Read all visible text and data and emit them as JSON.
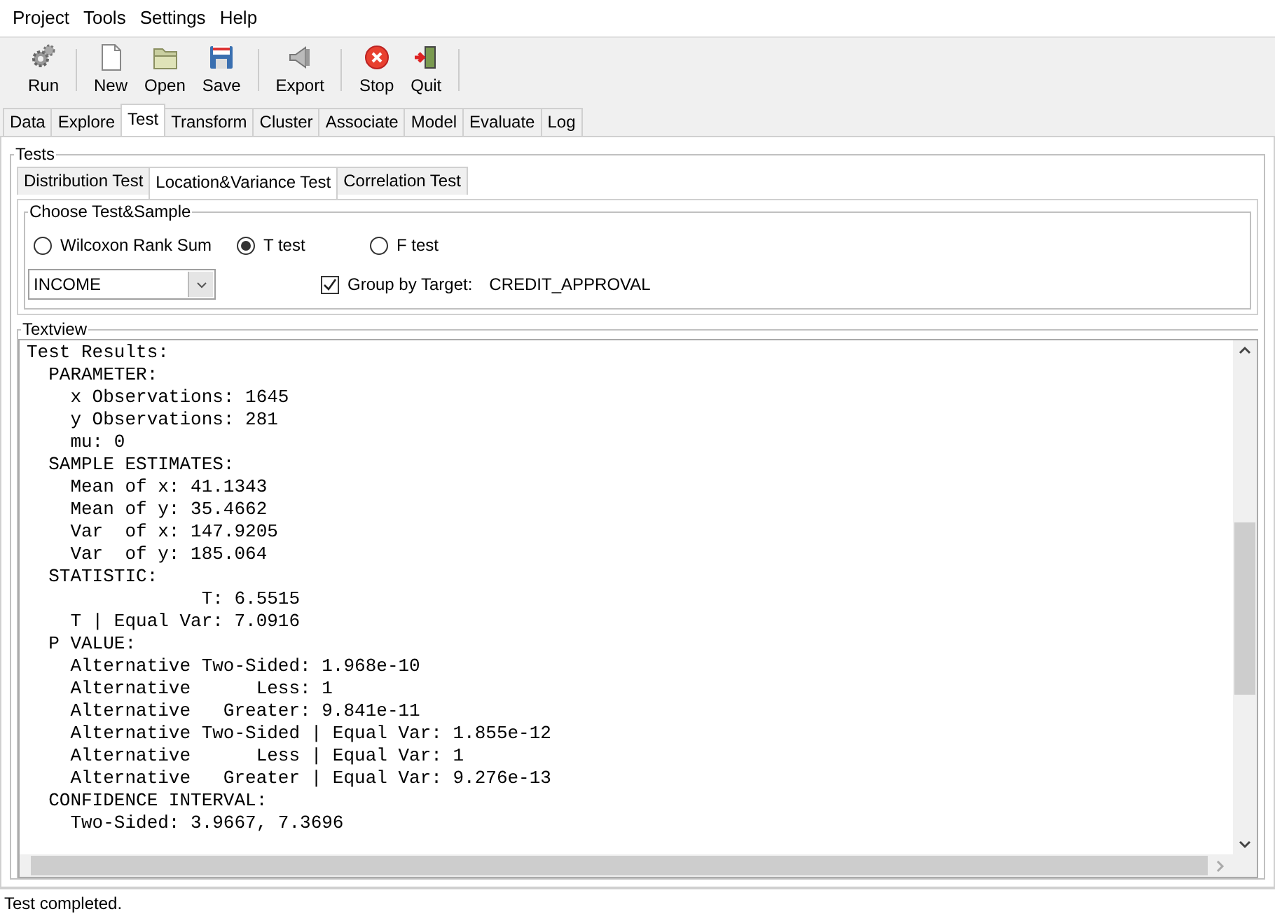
{
  "menu": [
    "Project",
    "Tools",
    "Settings",
    "Help"
  ],
  "toolbar": [
    {
      "label": "Run",
      "kind": "gears"
    },
    {
      "label": "New",
      "kind": "page"
    },
    {
      "label": "Open",
      "kind": "folder"
    },
    {
      "label": "Save",
      "kind": "disk"
    },
    {
      "label": "Export",
      "kind": "speaker"
    },
    {
      "label": "Stop",
      "kind": "stop"
    },
    {
      "label": "Quit",
      "kind": "exit"
    }
  ],
  "tabs": [
    {
      "label": "Data",
      "selected": false
    },
    {
      "label": "Explore",
      "selected": false
    },
    {
      "label": "Test",
      "selected": true
    },
    {
      "label": "Transform",
      "selected": false
    },
    {
      "label": "Cluster",
      "selected": false
    },
    {
      "label": "Associate",
      "selected": false
    },
    {
      "label": "Model",
      "selected": false
    },
    {
      "label": "Evaluate",
      "selected": false
    },
    {
      "label": "Log",
      "selected": false
    }
  ],
  "tests": {
    "title": "Tests",
    "tabs": [
      {
        "label": "Distribution Test",
        "selected": false
      },
      {
        "label": "Location&Variance Test",
        "selected": true
      },
      {
        "label": "Correlation Test",
        "selected": false
      }
    ],
    "choose": {
      "title": "Choose Test&Sample",
      "options": [
        {
          "label": "Wilcoxon Rank Sum",
          "selected": false
        },
        {
          "label": "T test",
          "selected": true
        },
        {
          "label": "F test",
          "selected": false
        }
      ],
      "variable": "INCOME",
      "group_by": {
        "label": "Group by Target:",
        "checked": true,
        "value": "CREDIT_APPROVAL"
      }
    },
    "textview": {
      "title": "Textview",
      "lines": [
        "Test Results:",
        "  PARAMETER:",
        "    x Observations: 1645",
        "    y Observations: 281",
        "    mu: 0",
        "  SAMPLE ESTIMATES:",
        "    Mean of x: 41.1343",
        "    Mean of y: 35.4662",
        "    Var  of x: 147.9205",
        "    Var  of y: 185.064",
        "  STATISTIC:",
        "                T: 6.5515",
        "    T | Equal Var: 7.0916",
        "  P VALUE:",
        "    Alternative Two-Sided: 1.968e-10",
        "    Alternative      Less: 1",
        "    Alternative   Greater: 9.841e-11",
        "    Alternative Two-Sided | Equal Var: 1.855e-12",
        "    Alternative      Less | Equal Var: 1",
        "    Alternative   Greater | Equal Var: 9.276e-13",
        "  CONFIDENCE INTERVAL:",
        "    Two-Sided: 3.9667, 7.3696"
      ]
    }
  },
  "status_bar": "Test completed."
}
